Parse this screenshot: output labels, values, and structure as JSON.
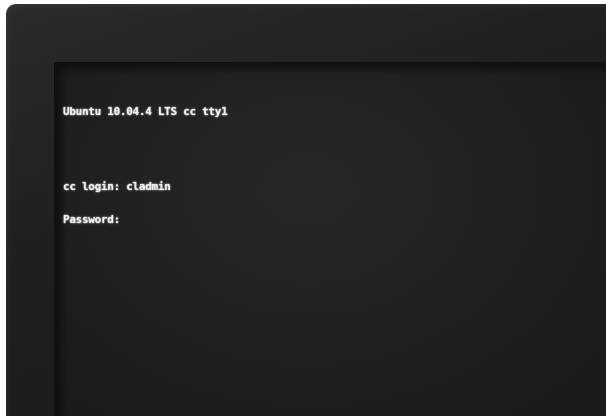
{
  "terminal": {
    "banner": "Ubuntu 10.04.4 LTS cc tty1",
    "login_prompt": "cc login: cladmin",
    "password_prompt": "Password:"
  }
}
